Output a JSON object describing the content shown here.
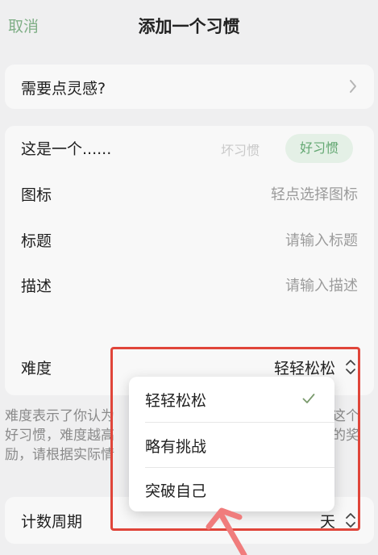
{
  "header": {
    "cancel_label": "取消",
    "title": "添加一个习惯"
  },
  "inspiration": {
    "label": "需要点灵感?"
  },
  "form": {
    "type_label": "这是一个......",
    "type_options": {
      "bad": "坏习惯",
      "good": "好习惯",
      "selected": "good"
    },
    "icon_label": "图标",
    "icon_placeholder": "轻点选择图标",
    "title_label": "标题",
    "title_placeholder": "请输入标题",
    "description_label": "描述",
    "description_placeholder": "请输入描述",
    "difficulty_label": "难度",
    "difficulty_value": "轻轻松松"
  },
  "difficulty_help": {
    "line1_left": "难度表示了你认为",
    "line1_right": "这个",
    "line2_left": "好习惯，难度越高",
    "line2_right": "的奖",
    "line3_left": "励，请根据实际情"
  },
  "period": {
    "label": "计数周期",
    "value": "天"
  },
  "dropdown": {
    "options": [
      {
        "label": "轻轻松松",
        "selected": true
      },
      {
        "label": "略有挑战",
        "selected": false
      },
      {
        "label": "突破自己",
        "selected": false
      }
    ]
  },
  "colors": {
    "accent_green": "#64a873",
    "cancel_green": "#7fae86",
    "highlight_red": "#e0453a",
    "background": "#efeff0"
  },
  "icons": {
    "inspiration_chevron": "chevron-right-icon",
    "updown": "chevron-updown-icon",
    "check": "check-icon",
    "arrow": "annotation-arrow-icon"
  }
}
